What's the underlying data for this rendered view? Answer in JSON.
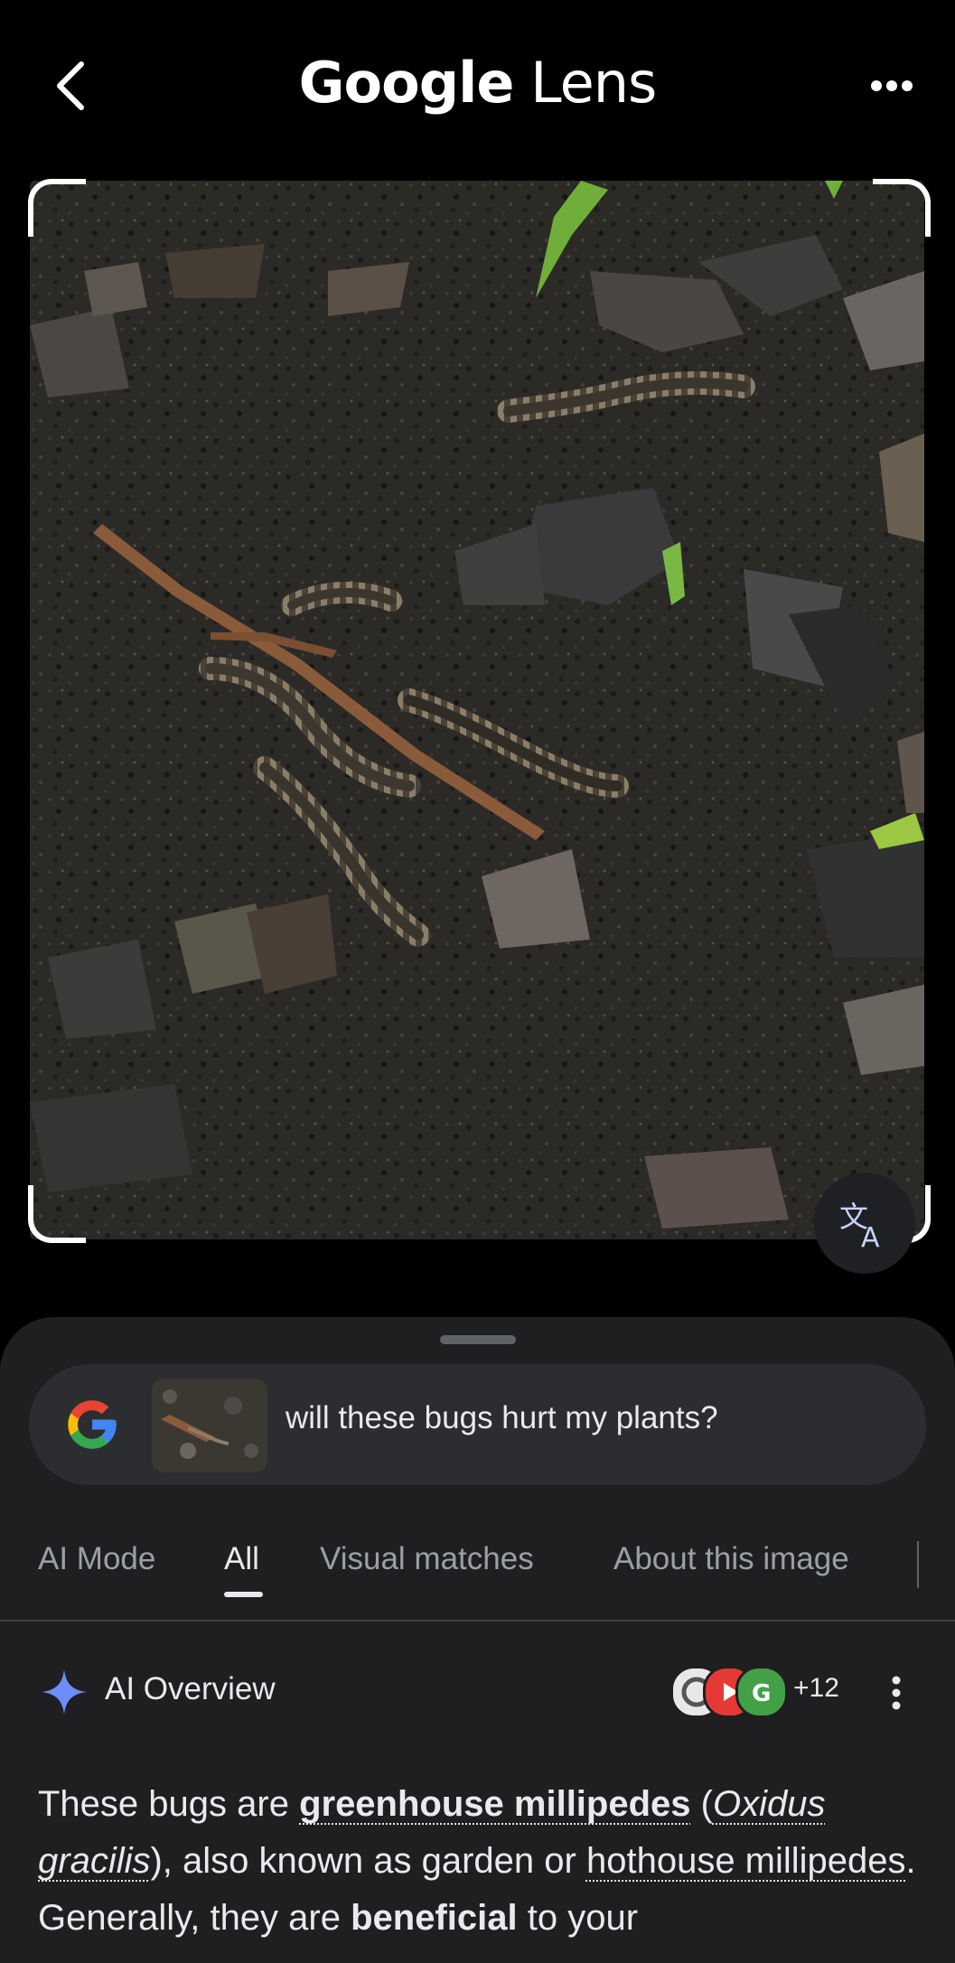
{
  "header": {
    "title_bold": "Google",
    "title_rest": "Lens",
    "back_icon": "chevron-left-icon",
    "more_icon": "more-horizontal-icon"
  },
  "translate": {
    "icon": "translate-icon",
    "label": "文A"
  },
  "search": {
    "logo": "google-g-icon",
    "query": "will these bugs hurt my plants?"
  },
  "tabs": [
    {
      "label": "AI Mode",
      "active": false
    },
    {
      "label": "All",
      "active": true
    },
    {
      "label": "Visual matches",
      "active": false
    },
    {
      "label": "About this image",
      "active": false
    }
  ],
  "ai_overview": {
    "title": "AI Overview",
    "source_count": "+12",
    "text": {
      "p1": "These bugs are ",
      "link1": "greenhouse millipedes",
      "p2": " (",
      "species1": "Oxidus",
      "species2": "gracilis",
      "p3": "), also known as garden or ",
      "link2": "hothouse millipedes",
      "p4": ". Generally, they are ",
      "bold1": "beneficial",
      "p5": " to your"
    }
  },
  "colors": {
    "background": "#000000",
    "sheet": "#1f1f21",
    "searchbar": "#2c2d30",
    "text_primary": "#e8eaed",
    "text_secondary": "#9aa0a6",
    "google_blue": "#4285F4",
    "google_red": "#EA4335",
    "google_yellow": "#FBBC05",
    "google_green": "#34A853"
  }
}
